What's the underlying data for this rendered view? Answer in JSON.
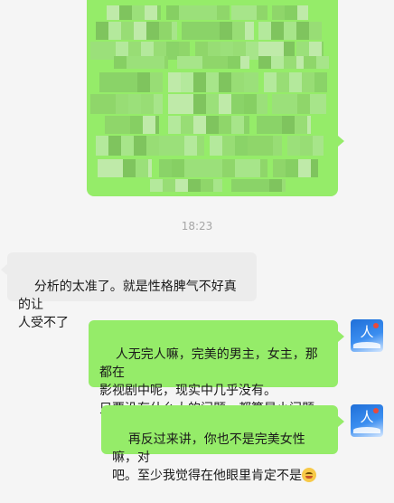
{
  "messages": [
    {
      "side": "right",
      "redacted": true
    },
    {
      "time": "18:23"
    },
    {
      "side": "left",
      "text": "分析的太准了。就是性格脾气不好真的让\n人受不了"
    },
    {
      "side": "right",
      "text": "人无完人嘛，完美的男主，女主，那都在\n影视剧中呢，现实中几乎没有。\n只要没有什么大的问题，都算是小问题。"
    },
    {
      "side": "right",
      "text": "再反过来讲，你也不是完美女性嘛，对\n吧。至少我觉得在他眼里肯定不是",
      "emoji": "grinning-sweat-emoji"
    }
  ],
  "avatar": {
    "glyph": "人",
    "icon": "blue-portrait-avatar",
    "accent": "#1f6fd8"
  },
  "colors": {
    "background": "#f5f5f5",
    "incoming_bubble": "#ececec",
    "outgoing_bubble": "#95ec69",
    "timestamp": "#a6a6a6"
  }
}
